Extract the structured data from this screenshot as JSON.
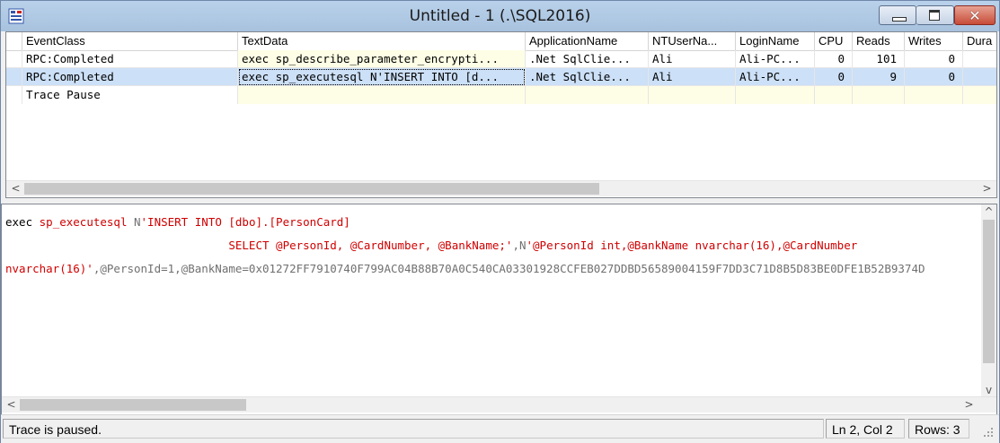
{
  "window": {
    "title": "Untitled - 1 (.\\SQL2016)"
  },
  "columns": [
    "EventClass",
    "TextData",
    "ApplicationName",
    "NTUserNa...",
    "LoginName",
    "CPU",
    "Reads",
    "Writes",
    "Dura"
  ],
  "rows": [
    {
      "EventClass": "RPC:Completed",
      "TextData": "exec sp_describe_parameter_encrypti...",
      "ApplicationName": ".Net SqlClie...",
      "NTUserName": "Ali",
      "LoginName": "Ali-PC...",
      "CPU": "0",
      "Reads": "101",
      "Writes": "0"
    },
    {
      "EventClass": "RPC:Completed",
      "TextData": "exec sp_executesql N'INSERT INTO [d...",
      "ApplicationName": ".Net SqlClie...",
      "NTUserName": "Ali",
      "LoginName": "Ali-PC...",
      "CPU": "0",
      "Reads": "9",
      "Writes": "0"
    },
    {
      "EventClass": "Trace Pause"
    }
  ],
  "detail": {
    "line1": {
      "kw": "exec ",
      "proc": "sp_executesql ",
      "prefix": "N",
      "str": "'INSERT INTO [dbo].[PersonCard]"
    },
    "line2": {
      "indent": "                                 ",
      "str": "SELECT @PersonId, @CardNumber, @BankName;'",
      "comma": ",",
      "prefix": "N",
      "str2": "'@PersonId int,@BankName nvarchar(16),@CardNumber"
    },
    "line3": {
      "str": "nvarchar(16)'",
      "rest": ",@PersonId=1,@BankName=0x01272FF7910740F799AC04B88B70A0C540CA03301928CCFEB027DDBD56589004159F7DD3C71D8B5D83BE0DFE1B52B9374D"
    }
  },
  "status": {
    "message": "Trace is paused.",
    "position": "Ln 2, Col 2",
    "rows": "Rows: 3"
  },
  "colors": {
    "selected_row": "#cce0f7",
    "string_red": "#d00000",
    "title_bar": "#b9d1ea"
  }
}
